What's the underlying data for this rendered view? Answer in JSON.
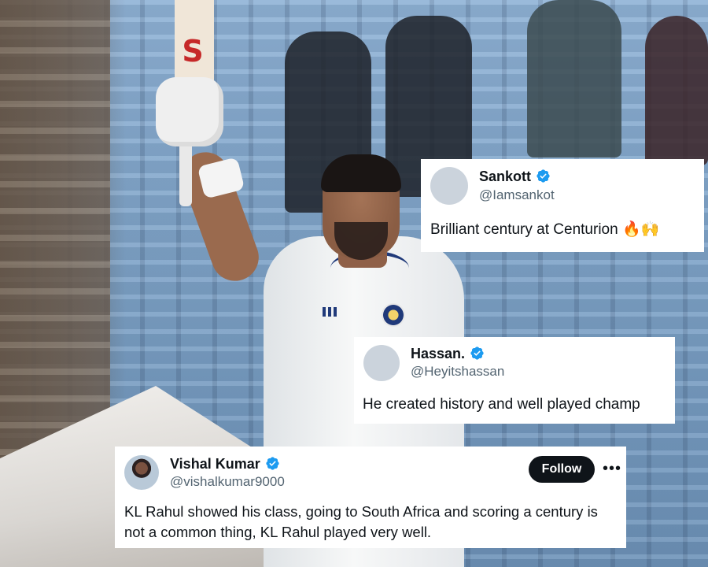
{
  "tweets": [
    {
      "name": "Sankott",
      "handle": "@Iamsankot",
      "text": "Brilliant century at Centurion 🔥🙌",
      "verified": true
    },
    {
      "name": "Hassan.",
      "handle": "@Heyitshassan",
      "text": "He created history and well played champ",
      "verified": true
    },
    {
      "name": "Vishal Kumar",
      "handle": "@vishalkumar9000",
      "text": "KL Rahul showed his class, going to South Africa and scoring a century is not a common thing, KL Rahul played very well.",
      "verified": true,
      "follow_label": "Follow",
      "more_label": "•••"
    }
  ],
  "colors": {
    "verified_badge": "#1d9bf0",
    "follow_button": "#0f1419",
    "handle_text": "#536471"
  },
  "icons": [
    "verified-badge-icon",
    "more-options-icon"
  ]
}
